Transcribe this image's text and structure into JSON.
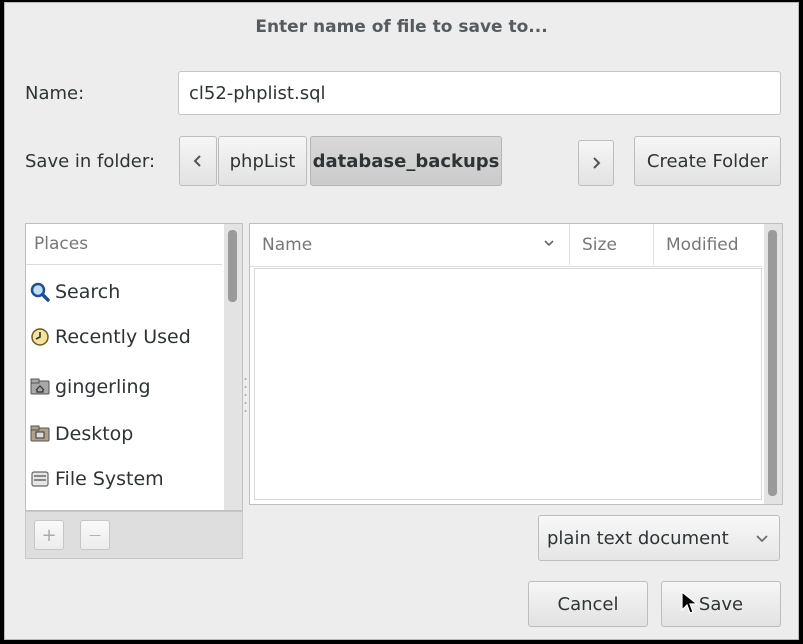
{
  "dialog": {
    "title": "Enter name of file to save to...",
    "name_label": "Name:",
    "name_value": "cl52-phplist.sql",
    "folder_label": "Save in folder:",
    "path": [
      "phpList",
      "database_backups"
    ],
    "back_icon": "chevron-left-icon",
    "forward_icon": "chevron-right-icon",
    "create_folder": "Create Folder"
  },
  "places": {
    "header": "Places",
    "items": [
      {
        "label": "Search",
        "icon": "search-icon"
      },
      {
        "label": "Recently Used",
        "icon": "clock-icon"
      },
      {
        "label": "gingerling",
        "icon": "home-folder-icon"
      },
      {
        "label": "Desktop",
        "icon": "desktop-folder-icon"
      },
      {
        "label": "File System",
        "icon": "drive-icon"
      }
    ],
    "add_label": "+",
    "remove_label": "—"
  },
  "files": {
    "columns": [
      "Name",
      "Size",
      "Modified"
    ],
    "rows": []
  },
  "filter": {
    "selected": "plain text document"
  },
  "actions": {
    "cancel": "Cancel",
    "save": "Save"
  }
}
